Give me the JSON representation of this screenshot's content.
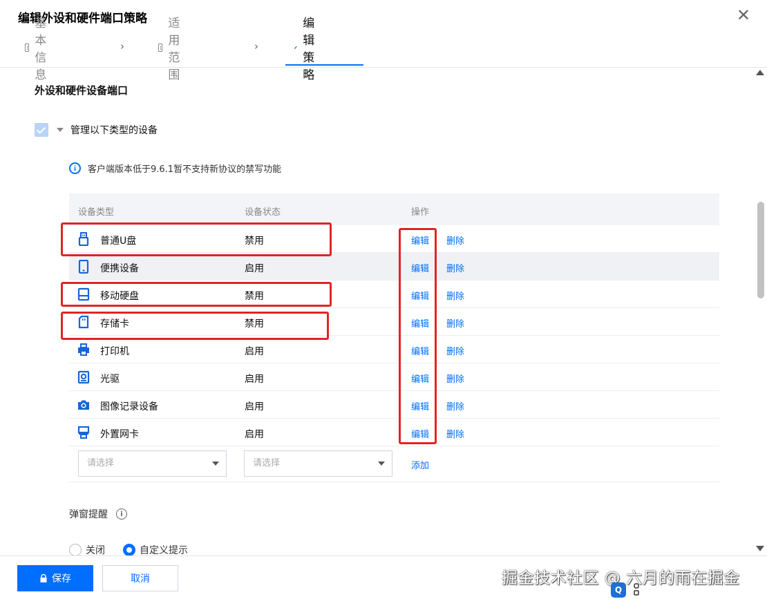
{
  "dialog": {
    "title": "编辑外设和硬件端口策略",
    "close_symbol": "✕"
  },
  "steps": [
    {
      "label": "基本信息",
      "icon": "form-icon"
    },
    {
      "label": "适用范围",
      "icon": "chart-icon"
    },
    {
      "label": "编辑策略",
      "icon": "pencil-icon",
      "active": true
    }
  ],
  "step_separator": "›",
  "section": {
    "title": "外设和硬件设备端口",
    "manage_label": "管理以下类型的设备",
    "info_text": "客户端版本低于9.6.1暂不支持新协议的禁写功能"
  },
  "table": {
    "headers": {
      "type": "设备类型",
      "status": "设备状态",
      "op": "操作"
    },
    "rows": [
      {
        "name": "普通U盘",
        "status": "禁用",
        "icon": "usb-icon"
      },
      {
        "name": "便携设备",
        "status": "启用",
        "icon": "phone-icon"
      },
      {
        "name": "移动硬盘",
        "status": "禁用",
        "icon": "hard-drive-icon"
      },
      {
        "name": "存储卡",
        "status": "禁用",
        "icon": "sd-card-icon"
      },
      {
        "name": "打印机",
        "status": "启用",
        "icon": "printer-icon"
      },
      {
        "name": "光驱",
        "status": "启用",
        "icon": "optical-drive-icon"
      },
      {
        "name": "图像记录设备",
        "status": "启用",
        "icon": "camera-icon"
      },
      {
        "name": "外置网卡",
        "status": "启用",
        "icon": "network-card-icon"
      }
    ],
    "edit_label": "编辑",
    "delete_label": "删除",
    "select_placeholder": "请选择",
    "add_label": "添加"
  },
  "popup": {
    "label": "弹窗提醒",
    "help_symbol": "i",
    "options": [
      {
        "label": "关闭",
        "checked": false
      },
      {
        "label": "自定义提示",
        "checked": true
      }
    ]
  },
  "footer": {
    "save_label": "保存",
    "cancel_label": "取消",
    "watermark": "掘金技术社区 @ 六月的雨在掘金",
    "tool_badge": "Q"
  },
  "colors": {
    "accent": "#006eff",
    "highlight": "#e02424"
  }
}
